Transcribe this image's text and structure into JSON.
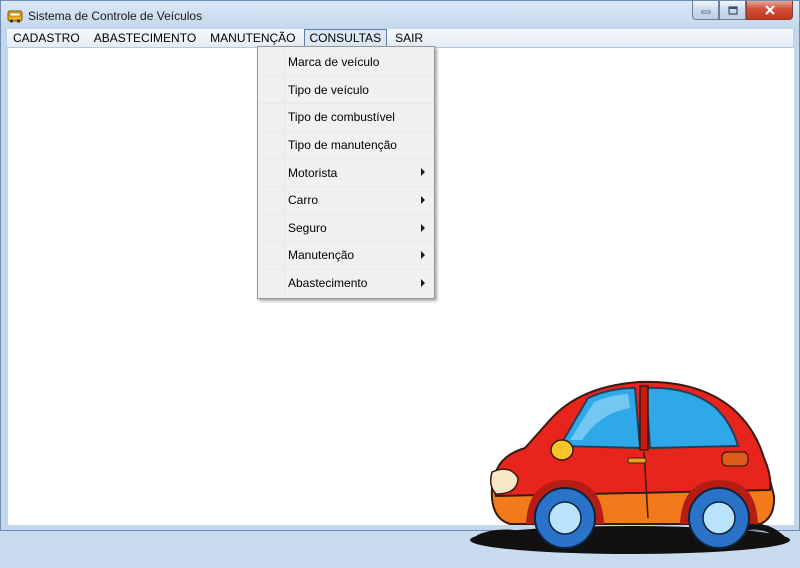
{
  "window": {
    "title": "Sistema de Controle de Veículos",
    "app_icon": "bus-icon"
  },
  "menubar": {
    "items": [
      {
        "label": "CADASTRO"
      },
      {
        "label": "ABASTECIMENTO"
      },
      {
        "label": "MANUTENÇÃO"
      },
      {
        "label": "CONSULTAS"
      },
      {
        "label": "SAIR"
      }
    ],
    "active": "CONSULTAS"
  },
  "consultas_menu": {
    "items": [
      {
        "label": "Marca de veículo",
        "submenu": false
      },
      {
        "label": "Tipo de veículo",
        "submenu": false
      },
      {
        "label": "Tipo de combustível",
        "submenu": false
      },
      {
        "label": "Tipo de manutenção",
        "submenu": false
      },
      {
        "label": "Motorista",
        "submenu": true
      },
      {
        "label": "Carro",
        "submenu": true
      },
      {
        "label": "Seguro",
        "submenu": true
      },
      {
        "label": "Manutenção",
        "submenu": true
      },
      {
        "label": "Abastecimento",
        "submenu": true
      }
    ]
  },
  "colors": {
    "car_body": "#e8251c",
    "car_window": "#2fa8e8",
    "wheel": "#2a73c9"
  }
}
